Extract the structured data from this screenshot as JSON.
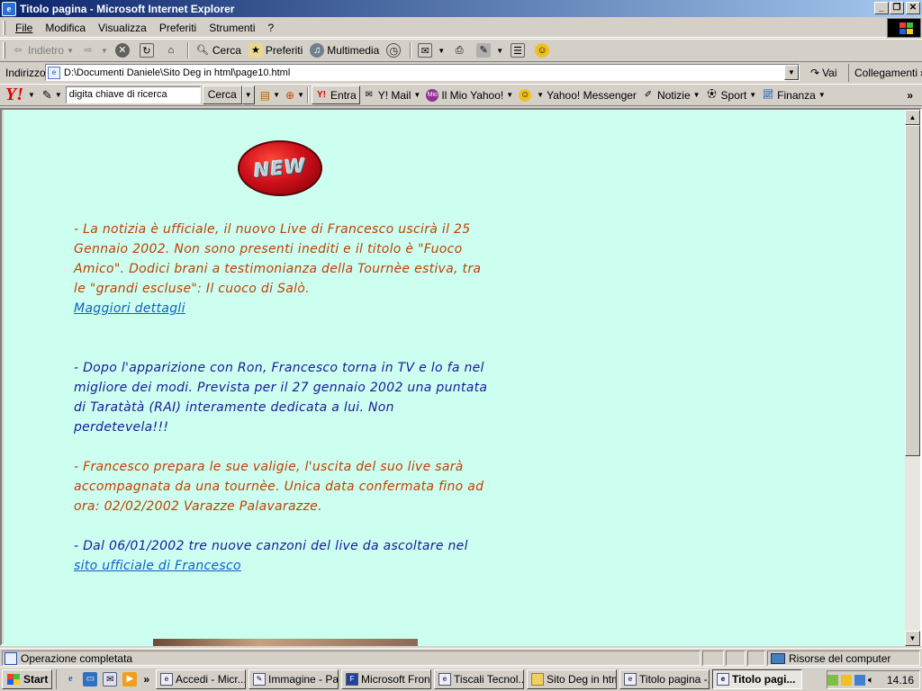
{
  "window": {
    "title": "Titolo pagina - Microsoft Internet Explorer",
    "buttons": {
      "minimize": "_",
      "maximize": "❐",
      "close": "✕"
    }
  },
  "menu": {
    "items": [
      {
        "key": "F",
        "rest": "ile"
      },
      {
        "key": "",
        "pre": "Modi",
        "mid": "f",
        "rest": "ica"
      },
      {
        "key": "V",
        "rest": "isualizza"
      },
      {
        "key": "P",
        "rest": "referiti"
      },
      {
        "key": "S",
        "rest": "trumenti"
      },
      {
        "key": "?",
        "rest": ""
      }
    ],
    "labels": [
      "File",
      "Modifica",
      "Visualizza",
      "Preferiti",
      "Strumenti",
      "?"
    ]
  },
  "toolbar": {
    "back": "Indietro",
    "search": "Cerca",
    "favorites": "Preferiti",
    "multimedia": "Multimedia"
  },
  "address": {
    "label": "Indirizzo",
    "value": "D:\\Documenti Daniele\\Sito Deg in html\\page10.html",
    "go": "Vai",
    "links": "Collegamenti",
    "links_more": "»"
  },
  "yahoo": {
    "logo": "Y!",
    "search_value": "digita chiave di ricerca",
    "search_button": "Cerca",
    "entra": "Entra",
    "mail": "Y! Mail",
    "my_yahoo": "Il Mio Yahoo!",
    "messenger": "Yahoo! Messenger",
    "news": "Notizie",
    "sport": "Sport",
    "finance": "Finanza",
    "more": "»"
  },
  "content": {
    "badge": "NEW",
    "news1": "- La notizia è ufficiale, il nuovo Live di Francesco uscirà il 25 Gennaio 2002. Non sono presenti inediti e il titolo è \"Fuoco Amico\". Dodici brani a testimonianza della Tournèe estiva, tra le \"grandi escluse\": Il cuoco di Salò.",
    "news1_link": "Maggiori dettagli",
    "news2": "- Dopo l'apparizione con Ron, Francesco torna in TV e lo fa nel migliore dei modi. Prevista per il 27 gennaio 2002 una puntata di Taratàtà (RAI) interamente dedicata a lui. Non perdetevela!!!",
    "news3": "- Francesco prepara le sue valigie, l'uscita del suo live sarà accompagnata da una tournèe. Unica data confermata fino ad ora: 02/02/2002  Varazze  Palavarazze.",
    "news4": "- Dal 06/01/2002 tre nuove canzoni del live da ascoltare nel",
    "news4_link": "sito ufficiale di Francesco"
  },
  "status": {
    "text": "Operazione completata",
    "zone": "Risorse del computer"
  },
  "taskbar": {
    "start": "Start",
    "more": "»",
    "tasks": [
      "Accedi - Micr...",
      "Immagine - Pa...",
      "Microsoft Fron...",
      "Tiscali Tecnol...",
      "Sito Deg in html",
      "Titolo pagina -...",
      "Titolo pagi..."
    ],
    "clock": "14.16"
  },
  "colors": {
    "page_bg": "#ccfff0",
    "news_red": "#c04000",
    "news_blue": "#1a1a9a",
    "link": "#1060c0",
    "titlebar": "#0a246a"
  }
}
